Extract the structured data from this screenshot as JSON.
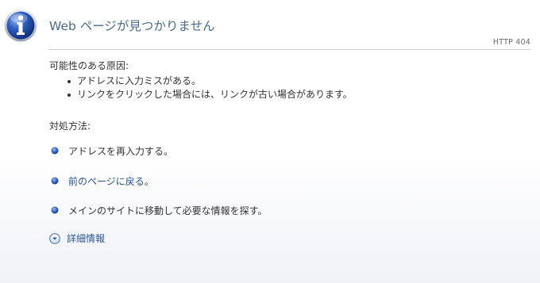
{
  "page": {
    "title": "Web ページが見つかりません",
    "status_code": "HTTP 404"
  },
  "causes": {
    "heading": "可能性のある原因:",
    "items": [
      "アドレスに入力ミスがある。",
      "リンクをクリックした場合には、リンクが古い場合があります。"
    ]
  },
  "fixes": {
    "heading": "対処方法:",
    "items": [
      "アドレスを再入力する。",
      "前のページに戻る。",
      "メインのサイトに移動して必要な情報を探す。"
    ]
  },
  "more_info": {
    "label": "詳細情報"
  },
  "icons": {
    "header": "info-icon",
    "fix_bullet": "blue-bullet-icon",
    "more_info": "chevron-down-circle-icon"
  },
  "colors": {
    "title": "#4a6a8f",
    "link": "#2a5595",
    "icon_blue": "#1e4fa8"
  }
}
